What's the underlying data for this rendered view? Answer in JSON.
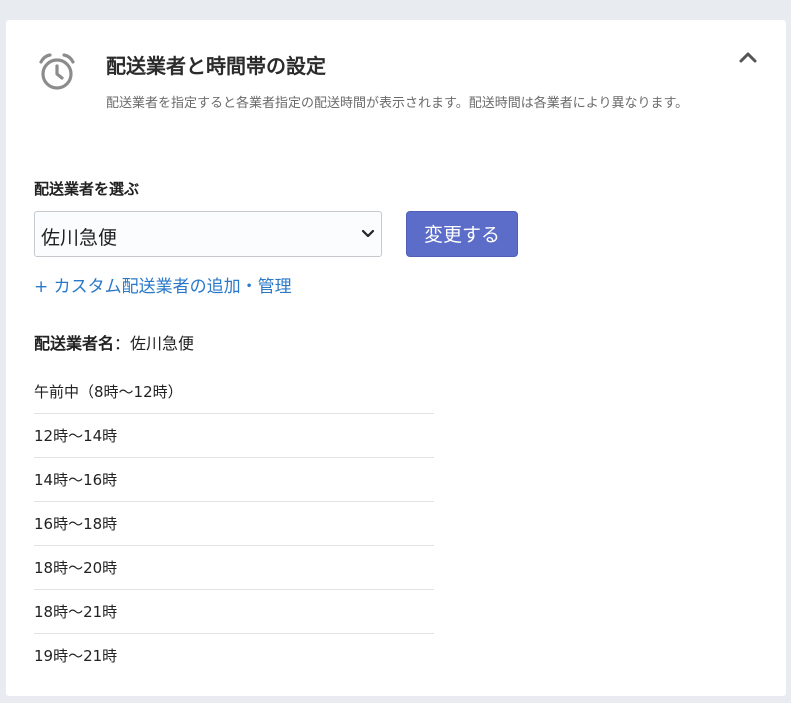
{
  "section": {
    "title": "配送業者と時間帯の設定",
    "description": "配送業者を指定すると各業者指定の配送時間が表示されます。配送時間は各業者により異なります。"
  },
  "carrier_select": {
    "label": "配送業者を選ぶ",
    "selected": "佐川急便"
  },
  "change_button": {
    "label": "変更する"
  },
  "custom_link": {
    "label": "+ カスタム配送業者の追加・管理"
  },
  "carrier_info": {
    "name_label": "配送業者名",
    "separator": "：",
    "name_value": "佐川急便"
  },
  "time_slots": [
    "午前中（8時～12時）",
    "12時～14時",
    "14時～16時",
    "16時～18時",
    "18時～20時",
    "18時～21時",
    "19時～21時"
  ],
  "icons": {
    "header": "alarm-clock-icon",
    "collapse": "chevron-up-icon",
    "select": "chevron-down-icon"
  },
  "colors": {
    "accent_button": "#5b6cc9",
    "link": "#2a79c8",
    "background": "#e8ebef"
  }
}
